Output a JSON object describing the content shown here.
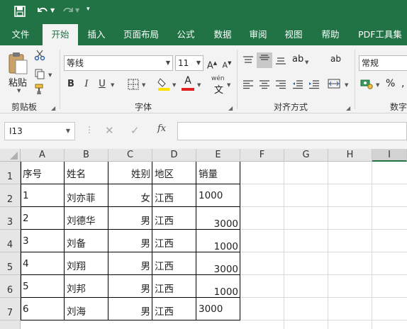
{
  "quick_access": {
    "save_icon": "save-icon",
    "undo_icon": "undo-icon",
    "redo_icon": "redo-icon",
    "customize_icon": "customize-toolbar-icon"
  },
  "tabs": [
    {
      "label": "文件"
    },
    {
      "label": "开始"
    },
    {
      "label": "插入"
    },
    {
      "label": "页面布局"
    },
    {
      "label": "公式"
    },
    {
      "label": "数据"
    },
    {
      "label": "审阅"
    },
    {
      "label": "视图"
    },
    {
      "label": "帮助"
    },
    {
      "label": "PDF工具集"
    }
  ],
  "ribbon": {
    "clipboard": {
      "paste_label": "粘贴",
      "group_label": "剪贴板"
    },
    "font": {
      "font_name": "等线",
      "font_size": "11",
      "group_label": "字体",
      "font_color": "#e02020",
      "highlight_color": "#ffe100",
      "phonetic": "wén"
    },
    "alignment": {
      "group_label": "对齐方式"
    },
    "number": {
      "format": "常规",
      "group_label": "数字"
    }
  },
  "formula_bar": {
    "name_box": "I13",
    "fx_label": "fx",
    "formula": ""
  },
  "columns": [
    "A",
    "B",
    "C",
    "D",
    "E",
    "F",
    "G",
    "H",
    "I"
  ],
  "selected_column": "I",
  "rows": [
    "1",
    "2",
    "3",
    "4",
    "5",
    "6",
    "7"
  ],
  "table": {
    "headers": [
      "序号",
      "姓名",
      "姓别",
      "地区",
      "销量"
    ],
    "data": [
      [
        "1",
        "刘亦菲",
        "女",
        "江西",
        "1000"
      ],
      [
        "2",
        "刘德华",
        "男",
        "江西",
        "3000"
      ],
      [
        "3",
        "刘备",
        "男",
        "江西",
        "1000"
      ],
      [
        "4",
        "刘翔",
        "男",
        "江西",
        "3000"
      ],
      [
        "5",
        "刘邦",
        "男",
        "江西",
        "1000"
      ],
      [
        "6",
        "刘海",
        "男",
        "江西",
        "3000"
      ]
    ]
  },
  "accent_color": "#217346"
}
